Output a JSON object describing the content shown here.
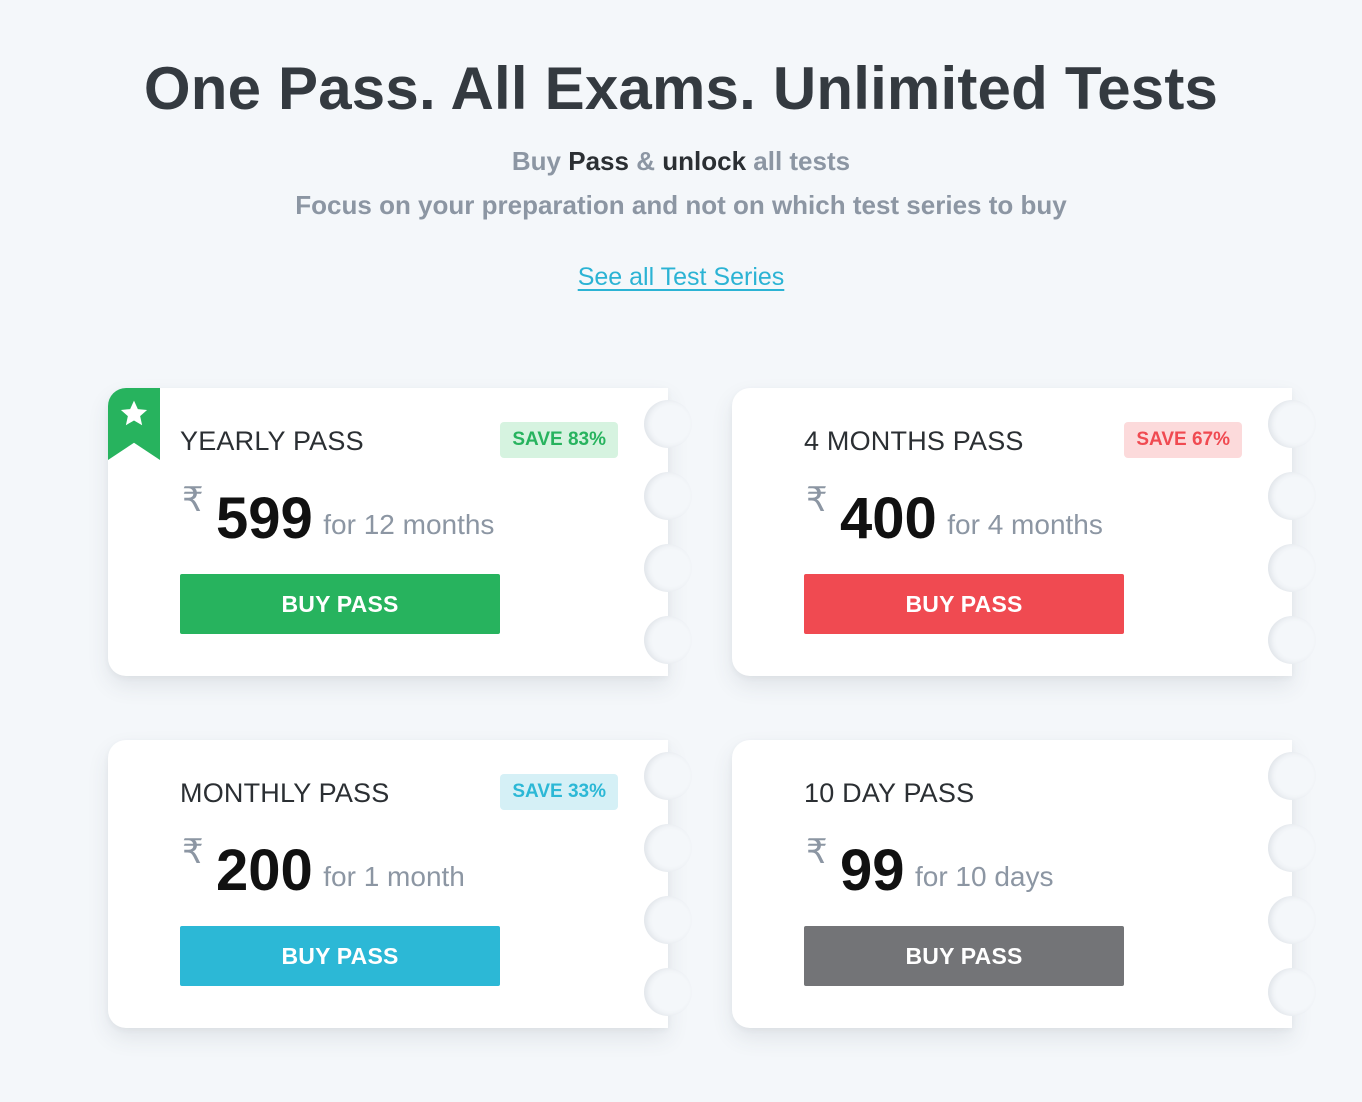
{
  "hero": {
    "title": "One Pass. All Exams. Unlimited Tests",
    "sub_buy": "Buy",
    "sub_pass": "Pass",
    "sub_amp": "&",
    "sub_unlock": "unlock",
    "sub_all_tests": "all tests",
    "subtitle2": "Focus on your preparation and not on which test series to buy",
    "link_label": "See all Test Series"
  },
  "currency_symbol": "₹",
  "colors": {
    "background": "#f4f7fa",
    "green": "#27b35e",
    "red": "#f04a51",
    "cyan": "#2cb8d6",
    "gray": "#737477"
  },
  "passes": [
    {
      "name": "YEARLY PASS",
      "badge": "SAVE 83%",
      "price": "599",
      "period": "for 12 months",
      "button_label": "BUY PASS",
      "featured_icon": "star-icon",
      "accent": "#27b35e",
      "badge_bg": "#d6f3e0",
      "badge_fg": "#27b35e"
    },
    {
      "name": "4 MONTHS PASS",
      "badge": "SAVE 67%",
      "price": "400",
      "period": "for 4 months",
      "button_label": "BUY PASS",
      "accent": "#f04a51",
      "badge_bg": "#fcdadb",
      "badge_fg": "#f04a51"
    },
    {
      "name": "MONTHLY PASS",
      "badge": "SAVE 33%",
      "price": "200",
      "period": "for 1 month",
      "button_label": "BUY PASS",
      "accent": "#2cb8d6",
      "badge_bg": "#d5f0f6",
      "badge_fg": "#2cb8d6"
    },
    {
      "name": "10 DAY PASS",
      "price": "99",
      "period": "for 10 days",
      "button_label": "BUY PASS",
      "accent": "#737477"
    }
  ]
}
